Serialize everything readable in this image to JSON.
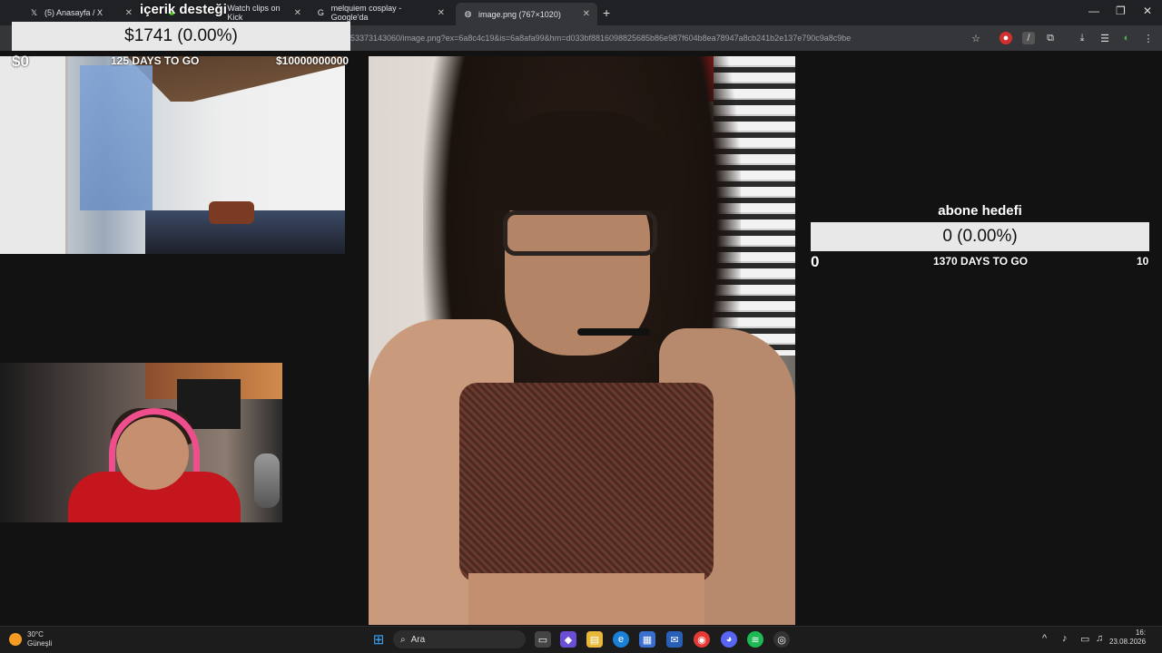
{
  "browser": {
    "tabs": [
      {
        "title": "(5) Anasayfa / X",
        "favicon": "x-logo"
      },
      {
        "title": "Watch clips on Kick",
        "favicon": "kick-logo"
      },
      {
        "title": "melquiem cosplay - Google'da",
        "favicon": "google-logo"
      },
      {
        "title": "image.png (767×1020)",
        "favicon": "globe"
      }
    ],
    "new_tab": "+",
    "url": "53373143060/image.png?ex=6a8c4c19&is=6a8afa99&hm=d033bf8816098825685b86e987f604b8ea78947a8cb241b2e137e790c9a8c9be",
    "window_controls": [
      "—",
      "❐",
      "✕"
    ]
  },
  "goal_left": {
    "title": "içerik desteği",
    "bar_text": "$1741 (0.00%)",
    "start": "$0",
    "days": "125 DAYS TO GO",
    "target": "$10000000000"
  },
  "goal_right": {
    "title": "abone hedefi",
    "bar_text": "0 (0.00%)",
    "start": "0",
    "days": "1370 DAYS TO GO",
    "target": "10"
  },
  "taskbar": {
    "weather_temp": "30°C",
    "weather_desc": "Güneşli",
    "search_placeholder": "Ara",
    "date": "23.08.2026",
    "time": "16:"
  },
  "colors": {
    "goal_bar_bg": "#e8e8e8",
    "background": "#121212",
    "taskbar": "#1c1c1c"
  }
}
